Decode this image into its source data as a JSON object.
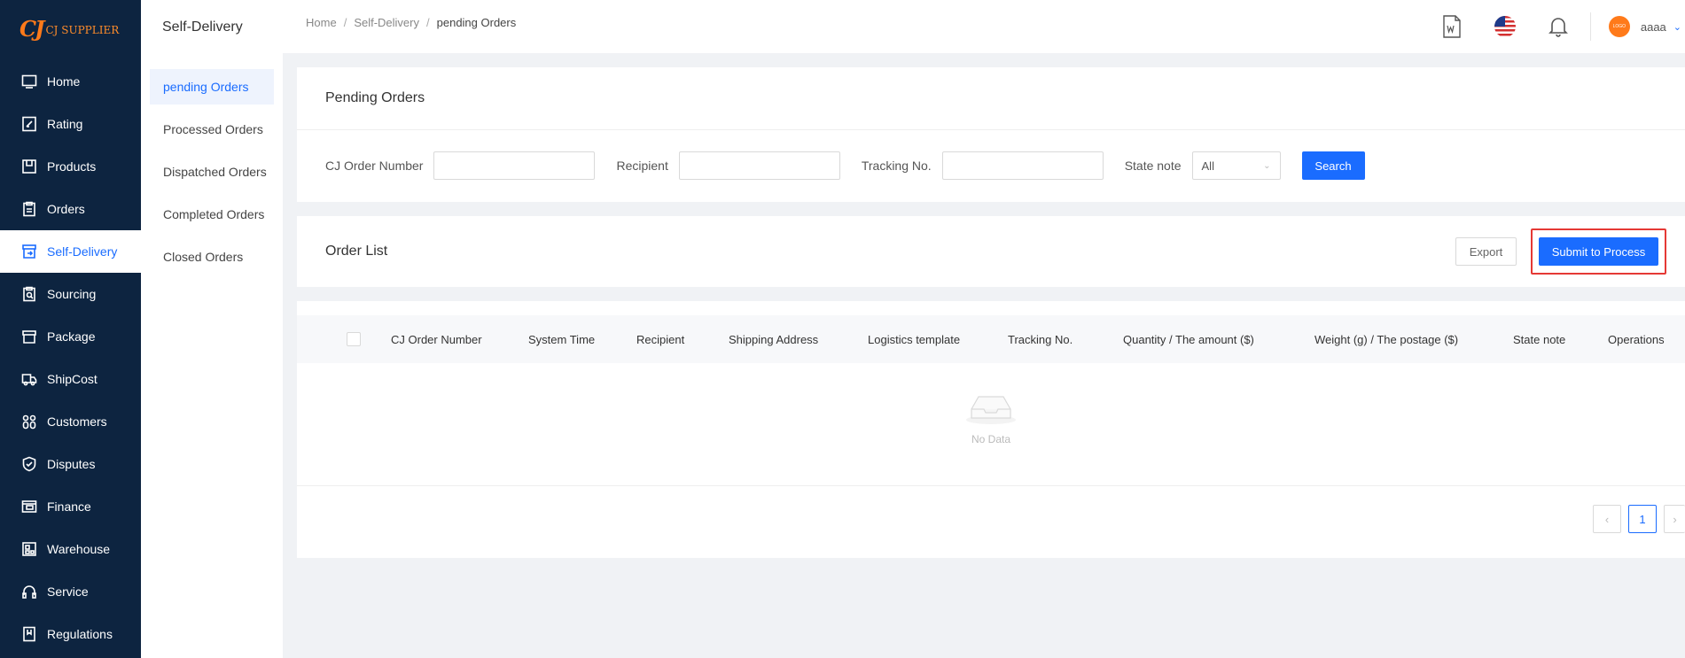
{
  "brand": {
    "logo_mark": "CJ",
    "logo_text": "CJ SUPPLIER"
  },
  "nav": [
    {
      "label": "Home",
      "icon": "monitor-icon"
    },
    {
      "label": "Rating",
      "icon": "rating-icon"
    },
    {
      "label": "Products",
      "icon": "products-icon"
    },
    {
      "label": "Orders",
      "icon": "orders-icon"
    },
    {
      "label": "Self-Delivery",
      "icon": "self-delivery-icon",
      "active": true
    },
    {
      "label": "Sourcing",
      "icon": "sourcing-icon"
    },
    {
      "label": "Package",
      "icon": "package-icon"
    },
    {
      "label": "ShipCost",
      "icon": "truck-icon"
    },
    {
      "label": "Customers",
      "icon": "customers-icon"
    },
    {
      "label": "Disputes",
      "icon": "shield-icon"
    },
    {
      "label": "Finance",
      "icon": "finance-icon"
    },
    {
      "label": "Warehouse",
      "icon": "warehouse-icon"
    },
    {
      "label": "Service",
      "icon": "headset-icon"
    },
    {
      "label": "Regulations",
      "icon": "regulations-icon"
    }
  ],
  "subnav": {
    "title": "Self-Delivery",
    "items": [
      "pending Orders",
      "Processed Orders",
      "Dispatched Orders",
      "Completed Orders",
      "Closed Orders"
    ]
  },
  "breadcrumb": [
    "Home",
    "Self-Delivery",
    "pending Orders"
  ],
  "header": {
    "username": "aaaa",
    "avatar_text": "LOGO"
  },
  "filters": {
    "title": "Pending Orders",
    "order_number_label": "CJ Order Number",
    "recipient_label": "Recipient",
    "tracking_label": "Tracking No.",
    "state_label": "State note",
    "state_value": "All",
    "search_label": "Search"
  },
  "order_list": {
    "title": "Order List",
    "export_label": "Export",
    "submit_label": "Submit to Process"
  },
  "table": {
    "columns": [
      "CJ Order Number",
      "System Time",
      "Recipient",
      "Shipping Address",
      "Logistics template",
      "Tracking No.",
      "Quantity / The amount ($)",
      "Weight (g) / The postage ($)",
      "State note",
      "Operations"
    ],
    "empty_text": "No Data"
  },
  "pagination": {
    "current_page": "1"
  },
  "colors": {
    "accent": "#1a6cff",
    "sidebar": "#0d2440",
    "highlight": "#e53935",
    "brand_orange": "#ff7a1a"
  }
}
